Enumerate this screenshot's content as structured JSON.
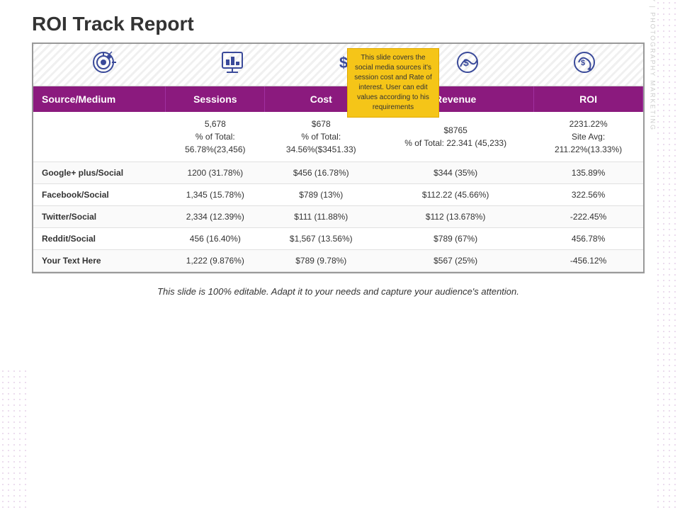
{
  "title": "ROI Track Report",
  "tooltip": {
    "text": "This slide covers the social media sources it's session cost and Rate of interest. User can edit values according to his requirements"
  },
  "icons": [
    "🎯",
    "📊",
    "$§",
    "💰",
    "🔄"
  ],
  "table": {
    "headers": [
      "Source/Medium",
      "Sessions",
      "Cost",
      "Revenue",
      "ROI"
    ],
    "summary_row": {
      "source": "",
      "sessions": "5,678\n% of Total:\n56.78%(23,456)",
      "cost": "$678\n% of Total:\n34.56%($3451.33)",
      "revenue": "$8765\n% of Total: 22.341 (45,233)",
      "roi": "2231.22%\nSite Avg:\n211.22%(13.33%)"
    },
    "rows": [
      {
        "source": "Google+ plus/Social",
        "sessions": "1200 (31.78%)",
        "cost": "$456 (16.78%)",
        "revenue": "$344 (35%)",
        "roi": "135.89%"
      },
      {
        "source": "Facebook/Social",
        "sessions": "1,345 (15.78%)",
        "cost": "$789 (13%)",
        "revenue": "$112.22 (45.66%)",
        "roi": "322.56%"
      },
      {
        "source": "Twitter/Social",
        "sessions": "2,334 (12.39%)",
        "cost": "$111 (11.88%)",
        "revenue": "$112 (13.678%)",
        "roi": "-222.45%"
      },
      {
        "source": "Reddit/Social",
        "sessions": "456 (16.40%)",
        "cost": "$1,567 (13.56%)",
        "revenue": "$789 (67%)",
        "roi": "456.78%"
      },
      {
        "source": "Your Text Here",
        "sessions": "1,222 (9.876%)",
        "cost": "$789 (9.78%)",
        "revenue": "$567 (25%)",
        "roi": "-456.12%"
      }
    ]
  },
  "bottom_text": "This slide is 100% editable. Adapt it to your needs and capture your audience's attention.",
  "watermark": "ENVIRAGALLERY | PHOTOGRAPHY MARKETING"
}
